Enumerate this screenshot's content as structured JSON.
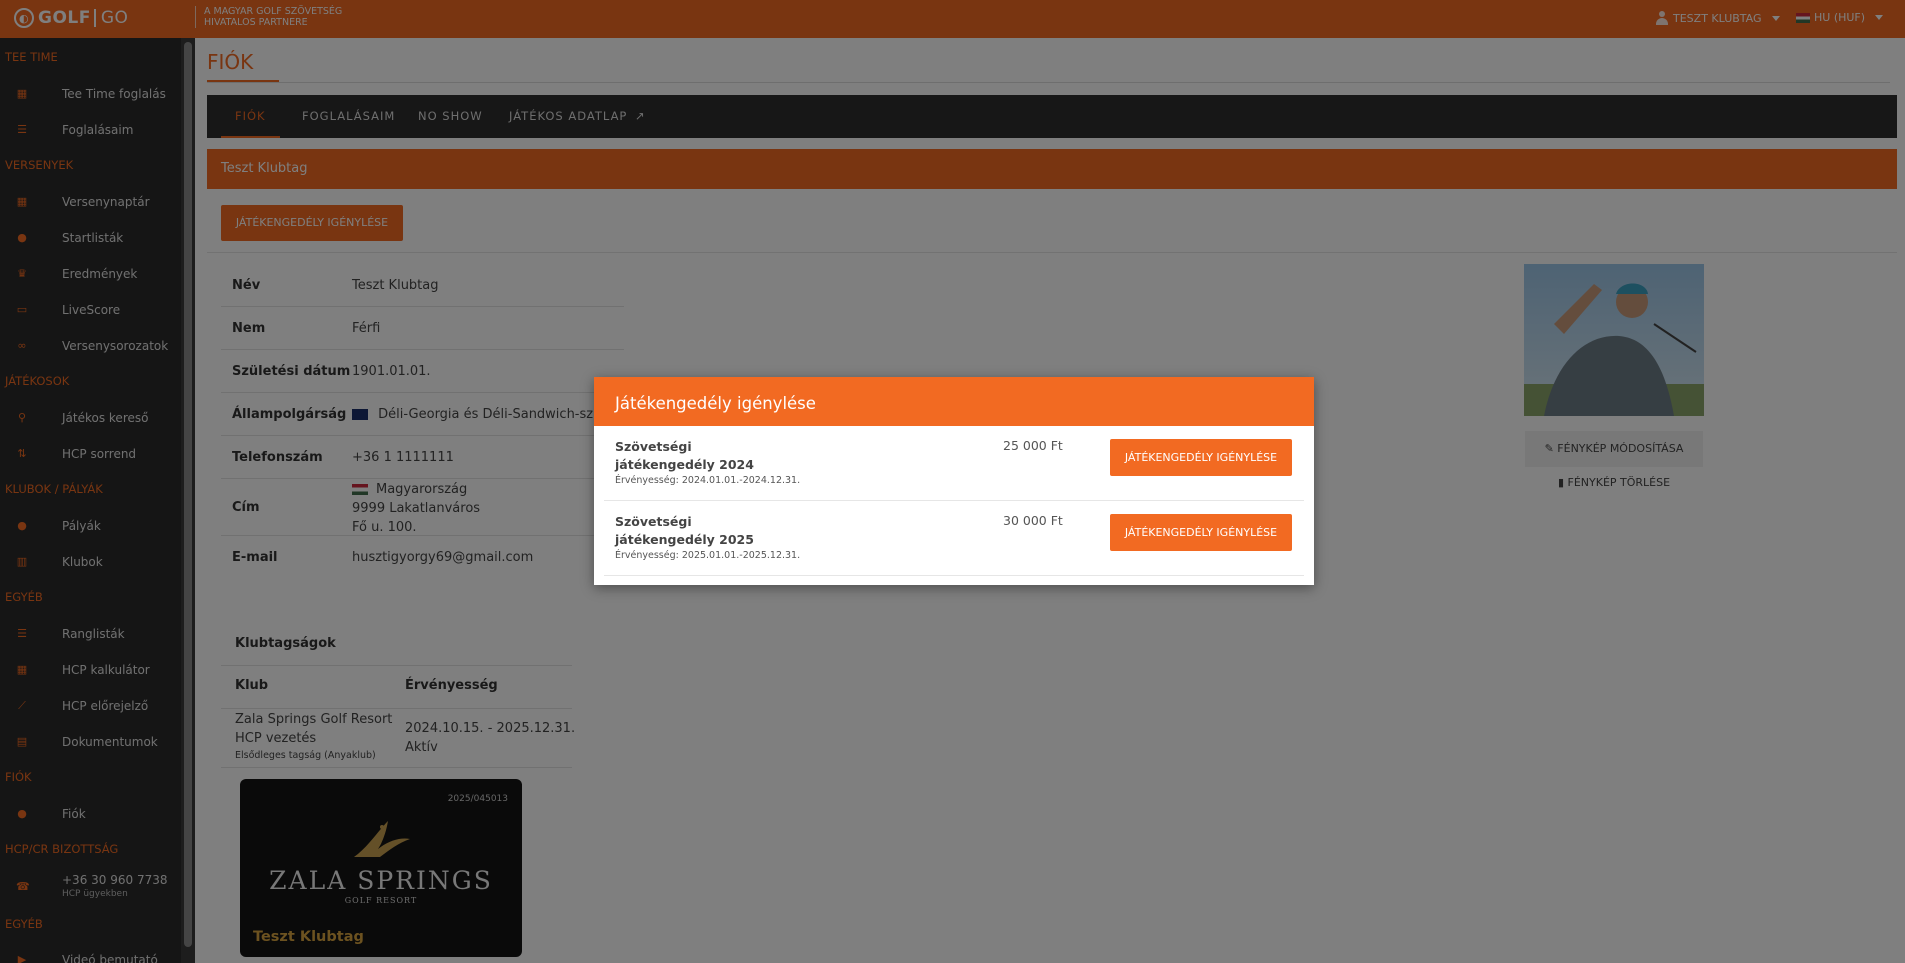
{
  "topbar": {
    "logo_golf": "GOLF",
    "logo_go": "GO",
    "partner_line1": "A MAGYAR GOLF SZÖVETSÉG",
    "partner_line2": "HIVATALOS PARTNERE",
    "user": "TESZT KLUBTAG",
    "language": "HU (HUF)"
  },
  "sidebar": {
    "sections": [
      {
        "title": "TEE TIME",
        "items": [
          {
            "label": "Tee Time foglalás",
            "icon": "calendar-icon"
          },
          {
            "label": "Foglalásaim",
            "icon": "list-icon"
          }
        ]
      },
      {
        "title": "VERSENYEK",
        "items": [
          {
            "label": "Versenynaptár",
            "icon": "calendar-icon"
          },
          {
            "label": "Startlisták",
            "icon": "flag-pin-icon"
          },
          {
            "label": "Eredmények",
            "icon": "trophy-icon"
          },
          {
            "label": "LiveScore",
            "icon": "cast-icon"
          },
          {
            "label": "Versenysorozatok",
            "icon": "link-icon"
          }
        ]
      },
      {
        "title": "JÁTÉKOSOK",
        "items": [
          {
            "label": "Játékos kereső",
            "icon": "running-icon"
          },
          {
            "label": "HCP sorrend",
            "icon": "sort-icon"
          }
        ]
      },
      {
        "title": "KLUBOK / PÁLYÁK",
        "items": [
          {
            "label": "Pályák",
            "icon": "map-pin-icon"
          },
          {
            "label": "Klubok",
            "icon": "building-icon"
          }
        ]
      },
      {
        "title": "EGYÉB",
        "items": [
          {
            "label": "Ranglisták",
            "icon": "list-icon"
          },
          {
            "label": "HCP kalkulátor",
            "icon": "calculator-icon"
          },
          {
            "label": "HCP előrejelző",
            "icon": "chart-icon"
          },
          {
            "label": "Dokumentumok",
            "icon": "document-icon"
          }
        ]
      },
      {
        "title": "FIÓK",
        "items": [
          {
            "label": "Fiók",
            "icon": "user-icon"
          }
        ]
      },
      {
        "title": "HCP/CR BIZOTTSÁG",
        "items": [
          {
            "label": "+36 30 960 7738",
            "sublabel": "HCP ügyekben",
            "icon": "headset-icon"
          }
        ]
      },
      {
        "title": "EGYÉB",
        "items": [
          {
            "label": "Videó bemutató",
            "icon": "video-icon"
          }
        ]
      }
    ]
  },
  "main": {
    "title": "FIÓK",
    "tabs": [
      {
        "label": "FIÓK"
      },
      {
        "label": "FOGLALÁSAIM"
      },
      {
        "label": "NO SHOW"
      },
      {
        "label": "JÁTÉKOS ADATLAP"
      }
    ],
    "panel_title": "Teszt Klubtag",
    "request_button": "JÁTÉKENGEDÉLY IGÉNYLÉSE",
    "profile": [
      {
        "key": "Név",
        "value": "Teszt Klubtag"
      },
      {
        "key": "Nem",
        "value": "Férfi"
      },
      {
        "key": "Születési dátum",
        "value": "1901.01.01."
      },
      {
        "key": "Állampolgárság",
        "value": "Déli-Georgia és Déli-Sandwich-szigetek"
      },
      {
        "key": "Telefonszám",
        "value": "+36 1 1111111"
      },
      {
        "key": "Cím",
        "country": "Magyarország",
        "city": "9999 Lakatlanváros",
        "street": "Fő u. 100."
      },
      {
        "key": "E-mail",
        "value": "husztigyorgy69@gmail.com"
      }
    ],
    "photo_edit": "FÉNYKÉP MÓDOSÍTÁSA",
    "photo_delete": "FÉNYKÉP TÖRLÉSE",
    "memberships": {
      "title": "Klubtagságok",
      "headers": [
        "Klub",
        "Érvényesség"
      ],
      "rows": [
        {
          "club": "Zala Springs Golf Resort",
          "club2": "HCP vezetés",
          "note": "Elsődleges tagság (Anyaklub)",
          "validity": "2024.10.15. - 2025.12.31.",
          "status": "Aktív"
        }
      ]
    },
    "card": {
      "number": "2025/045013",
      "brand": "ZALA SPRINGS",
      "brand_sub": "GOLF RESORT",
      "holder": "Teszt Klubtag"
    }
  },
  "modal": {
    "title": "Játékengedély igénylése",
    "licenses": [
      {
        "name": "Szövetségi játékengedély 2024",
        "validity": "Érvényesség: 2024.01.01.-2024.12.31.",
        "price": "25 000 Ft",
        "button": "JÁTÉKENGEDÉLY IGÉNYLÉSE"
      },
      {
        "name": "Szövetségi játékengedély 2025",
        "validity": "Érvényesség: 2025.01.01.-2025.12.31.",
        "price": "30 000 Ft",
        "button": "JÁTÉKENGEDÉLY IGÉNYLÉSE"
      }
    ]
  },
  "colors": {
    "accent": "#f26a22",
    "sidebar": "#2b2b2b",
    "tabbar": "#2f2f2f"
  }
}
